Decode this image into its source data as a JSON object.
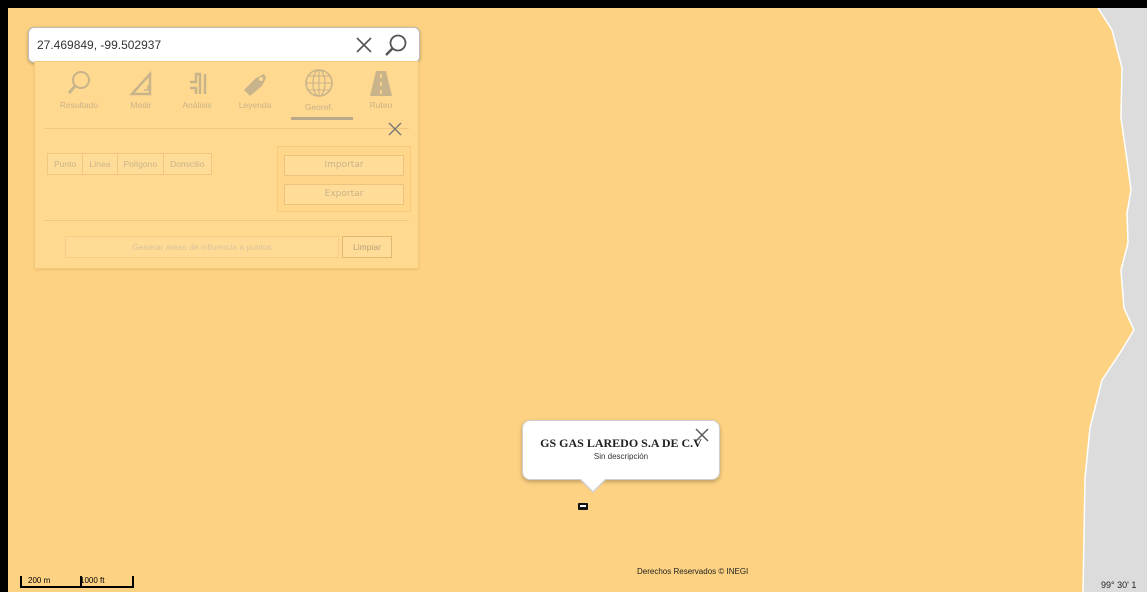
{
  "search": {
    "value": "27.469849, -99.502937"
  },
  "tools": [
    {
      "label": "Resultado",
      "icon": "search-icon"
    },
    {
      "label": "Medir",
      "icon": "ruler-triangle-icon"
    },
    {
      "label": "Análisis",
      "icon": "analysis-icon"
    },
    {
      "label": "Leyenda",
      "icon": "tag-icon"
    },
    {
      "label": "Georef.",
      "icon": "globe-icon"
    },
    {
      "label": "Ruteo",
      "icon": "road-icon"
    }
  ],
  "active_tool": "Georef.",
  "geometry_options": [
    "Punto",
    "Línea",
    "Polígono",
    "Domicilio"
  ],
  "io": {
    "import_label": "Importar",
    "export_label": "Exportar"
  },
  "influence": {
    "button_label": "Generar áreas de influencia a puntos",
    "clear_label": "Limpiar"
  },
  "popup": {
    "title": "GS GAS LAREDO S.A DE C.V",
    "description": "Sin descripción"
  },
  "scale": {
    "metric": "200 m",
    "imperial": "1000 ft"
  },
  "attribution": "Derechos Reservados © INEGI",
  "coordinates_readout": "99° 30' 1",
  "colors": {
    "map_fill": "#fdd282",
    "outside_area": "#dcdcdc",
    "panel_bg": "#ffd98f"
  }
}
